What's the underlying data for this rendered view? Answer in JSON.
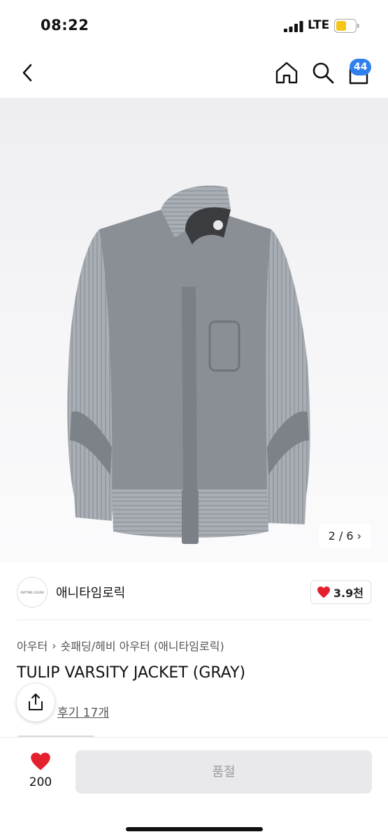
{
  "status_bar": {
    "time": "08:22",
    "network": "LTE"
  },
  "nav": {
    "cart_count": "44"
  },
  "gallery": {
    "counter": "2 / 6",
    "counter_chevron": "›"
  },
  "brand": {
    "logo_text": "ANYTIME LOGRIK",
    "name": "애니타임로릭",
    "likes": "3.9천"
  },
  "breadcrumb": {
    "level1": "아우터",
    "separator": "›",
    "level2": "숏패딩/헤비 아우터 (애니타임로릭)"
  },
  "product": {
    "title": "TULIP VARSITY JACKET (GRAY)",
    "reviews": "후기 17개"
  },
  "bottom_bar": {
    "wish_count": "200",
    "primary_button": "품절"
  },
  "colors": {
    "accent_blue": "#2f80ed",
    "heart_red": "#e5202e",
    "disabled_bg": "#e9e9ec"
  },
  "icons": [
    "back-icon",
    "home-icon",
    "search-icon",
    "shopping-bag-icon",
    "heart-icon",
    "share-icon"
  ]
}
